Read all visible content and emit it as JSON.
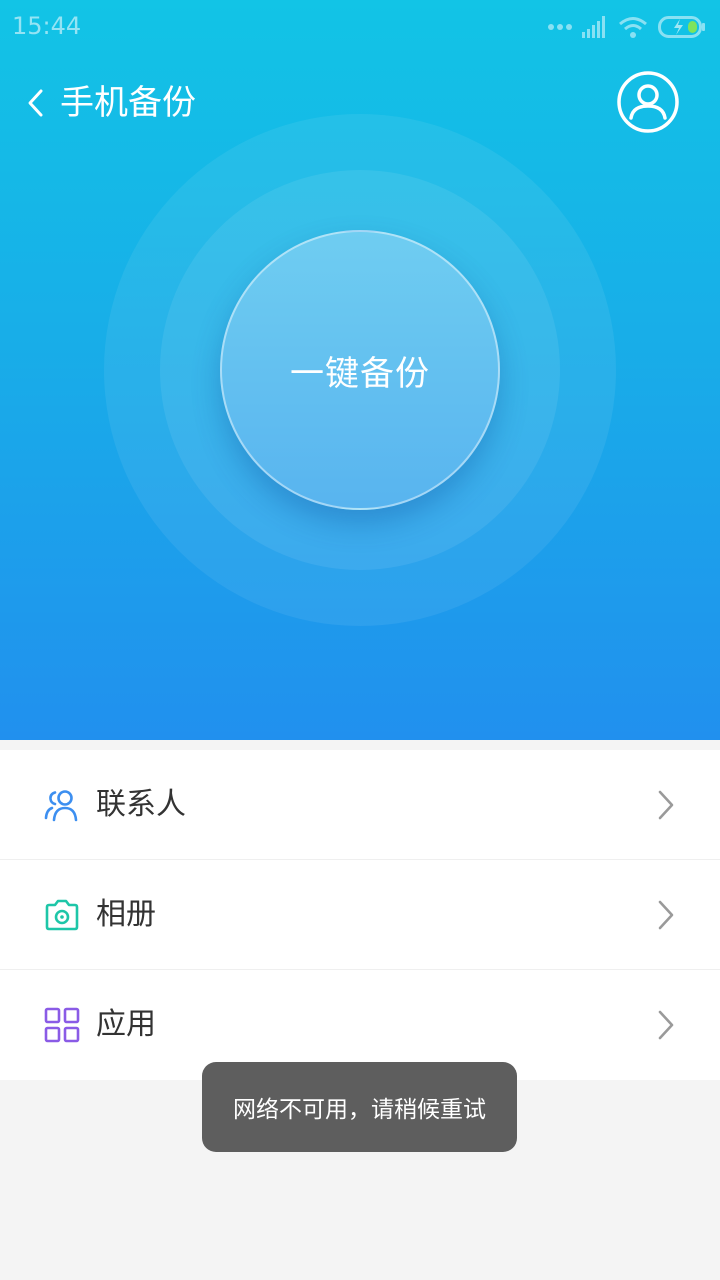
{
  "status_bar": {
    "time": "15:44",
    "icons": [
      "signal-dots-icon",
      "cell-signal-icon",
      "wifi-icon",
      "battery-charging-icon"
    ]
  },
  "header": {
    "back_icon": "chevron-left-icon",
    "title": "手机备份",
    "account_icon": "user-circle-icon"
  },
  "hero": {
    "backup_button_label": "一键备份"
  },
  "list": {
    "items": [
      {
        "label": "联系人",
        "icon": "contacts-icon",
        "icon_color": "#3d8ff0"
      },
      {
        "label": "相册",
        "icon": "camera-icon",
        "icon_color": "#1ec6a8"
      },
      {
        "label": "应用",
        "icon": "apps-grid-icon",
        "icon_color": "#8a5be6"
      }
    ]
  },
  "toast": {
    "message": "网络不可用，请稍候重试"
  },
  "colors": {
    "hero_top": "#12c4e6",
    "hero_bottom": "#2190ee",
    "chevron": "#9a9a9a",
    "toast_bg": "#5e5e5e"
  }
}
